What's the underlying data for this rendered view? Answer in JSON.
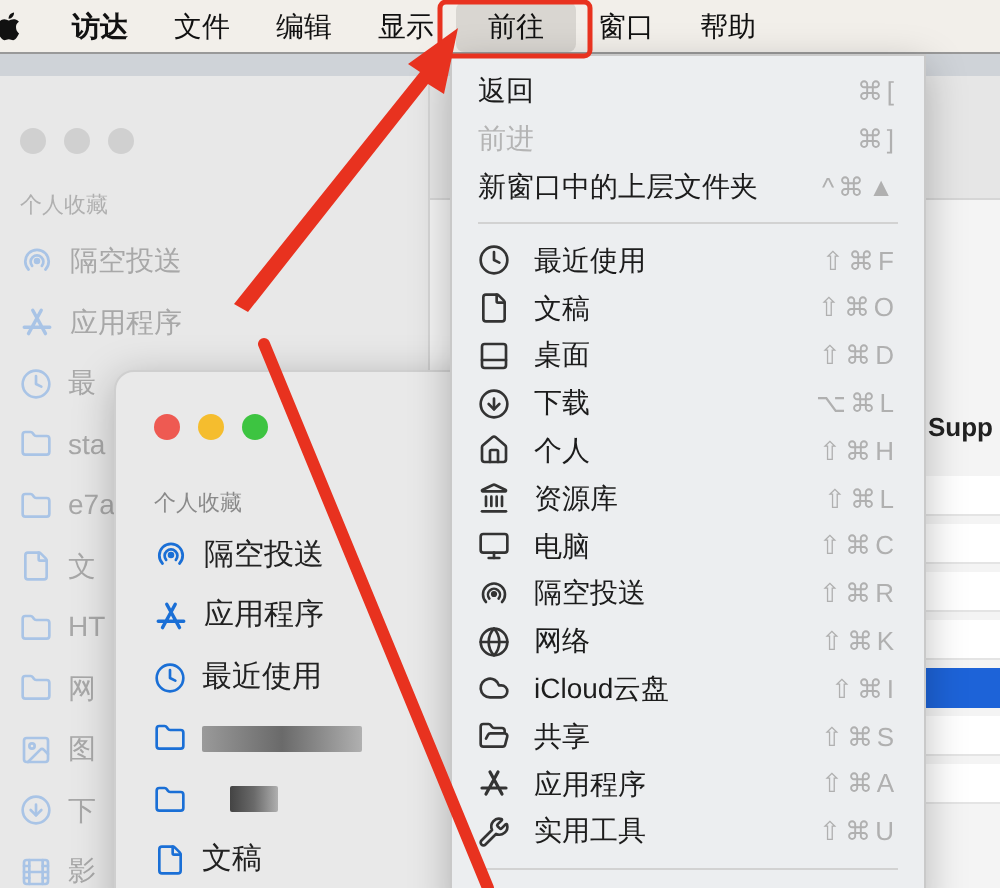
{
  "menu_bar": {
    "items": [
      {
        "label": "访达",
        "selected": false,
        "bold": true
      },
      {
        "label": "文件",
        "selected": false,
        "bold": false
      },
      {
        "label": "编辑",
        "selected": false,
        "bold": false
      },
      {
        "label": "显示",
        "selected": false,
        "bold": false
      },
      {
        "label": "前往",
        "selected": true,
        "bold": false
      },
      {
        "label": "窗口",
        "selected": false,
        "bold": false
      },
      {
        "label": "帮助",
        "selected": false,
        "bold": false
      }
    ]
  },
  "back_window": {
    "active": false,
    "sidebar_heading": "个人收藏",
    "sidebar_items": [
      {
        "label": "隔空投送"
      },
      {
        "label": "应用程序"
      },
      {
        "label": "最"
      },
      {
        "label": "sta"
      },
      {
        "label": "e7a"
      },
      {
        "label": "文"
      },
      {
        "label": "HT"
      },
      {
        "label": "网"
      },
      {
        "label": "图"
      },
      {
        "label": "下"
      },
      {
        "label": "影"
      }
    ],
    "content_heading": "Supp",
    "content_rows": [
      {
        "selected": false
      },
      {
        "selected": false
      },
      {
        "selected": false
      },
      {
        "selected": false
      },
      {
        "selected": true
      },
      {
        "selected": false
      },
      {
        "selected": false
      }
    ]
  },
  "front_window": {
    "active": true,
    "sidebar_heading": "个人收藏",
    "sidebar_items": [
      {
        "kind": "item",
        "label": "隔空投送"
      },
      {
        "kind": "item",
        "label": "应用程序"
      },
      {
        "kind": "item",
        "label": "最近使用"
      },
      {
        "kind": "redacted"
      },
      {
        "kind": "redacted"
      },
      {
        "kind": "item",
        "label": "文稿"
      }
    ]
  },
  "go_menu": {
    "sections": [
      [
        {
          "label": "返回",
          "shortcut": "⌘[",
          "disabled": false
        },
        {
          "label": "前进",
          "shortcut": "⌘]",
          "disabled": true
        },
        {
          "label": "新窗口中的上层文件夹",
          "shortcut": "^⌘▲",
          "disabled": false
        }
      ],
      [
        {
          "label": "最近使用",
          "shortcut": "⇧⌘F",
          "disabled": false
        },
        {
          "label": "文稿",
          "shortcut": "⇧⌘O",
          "disabled": false
        },
        {
          "label": "桌面",
          "shortcut": "⇧⌘D",
          "disabled": false
        },
        {
          "label": "下载",
          "shortcut": "⌥⌘L",
          "disabled": false
        },
        {
          "label": "个人",
          "shortcut": "⇧⌘H",
          "disabled": false
        },
        {
          "label": "资源库",
          "shortcut": "⇧⌘L",
          "disabled": false
        },
        {
          "label": "电脑",
          "shortcut": "⇧⌘C",
          "disabled": false
        },
        {
          "label": "隔空投送",
          "shortcut": "⇧⌘R",
          "disabled": false
        },
        {
          "label": "网络",
          "shortcut": "⇧⌘K",
          "disabled": false
        },
        {
          "label": "iCloud云盘",
          "shortcut": "⇧⌘I",
          "disabled": false
        },
        {
          "label": "共享",
          "shortcut": "⇧⌘S",
          "disabled": false
        },
        {
          "label": "应用程序",
          "shortcut": "⇧⌘A",
          "disabled": false
        },
        {
          "label": "实用工具",
          "shortcut": "⇧⌘U",
          "disabled": false
        }
      ]
    ]
  }
}
